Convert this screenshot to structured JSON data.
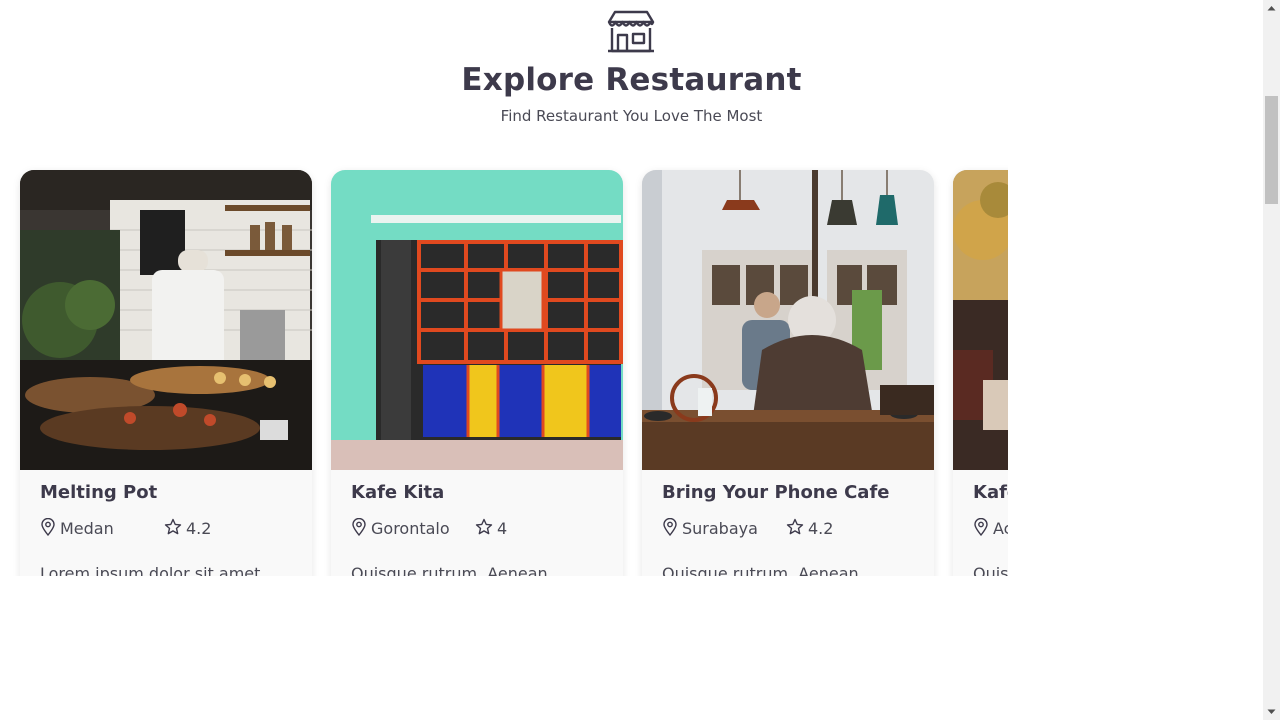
{
  "header": {
    "icon": "store-icon",
    "title": "Explore Restaurant",
    "subtitle": "Find Restaurant You Love The Most"
  },
  "restaurants": [
    {
      "name": "Melting Pot",
      "city": "Medan",
      "rating": "4.2",
      "description": "Lorem ipsum dolor sit amet",
      "image": "cafe-counter-photo"
    },
    {
      "name": "Kafe Kita",
      "city": "Gorontalo",
      "rating": "4",
      "description": "Quisque rutrum. Aenean",
      "image": "colorful-storefront-photo"
    },
    {
      "name": "Bring Your Phone Cafe",
      "city": "Surabaya",
      "rating": "4.2",
      "description": "Quisque rutrum. Aenean",
      "image": "man-at-cafe-table-photo"
    },
    {
      "name": "Kafe",
      "city": "Ac",
      "rating": "",
      "description": "Quis",
      "image": "autumn-cafe-photo"
    }
  ],
  "icons": {
    "location": "map-pin-icon",
    "rating": "star-icon"
  },
  "colors": {
    "text": "#3d3a4b",
    "card": "#f9f9f9",
    "background": "#ffffff"
  }
}
